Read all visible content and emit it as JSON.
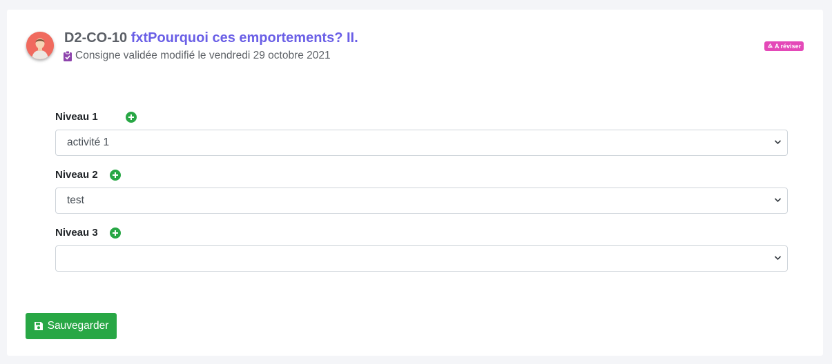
{
  "header": {
    "avatar_icon": "user-avatar-icon",
    "code": "D2-CO-10",
    "title": "fxtPourquoi ces emportements? II.",
    "subtitle_icon": "clipboard-check-icon",
    "subtitle": "Consigne validée modifié le vendredi 29 octobre 2021",
    "badge_icon": "recycle-icon",
    "badge": "A réviser"
  },
  "levels": [
    {
      "label": "Niveau 1",
      "add_icon": "plus-circle-icon",
      "selected": "activité 1"
    },
    {
      "label": "Niveau 2",
      "add_icon": "plus-circle-icon",
      "selected": "test"
    },
    {
      "label": "Niveau 3",
      "add_icon": "plus-circle-icon",
      "selected": ""
    }
  ],
  "save_button": {
    "icon": "floppy-disk-icon",
    "label": "Sauvegarder"
  },
  "colors": {
    "page_bg": "#f4f5f8",
    "title_accent": "#6a5fe6",
    "badge": "#e449b8",
    "success": "#28a745",
    "avatar_bg": "#f06a5e"
  }
}
